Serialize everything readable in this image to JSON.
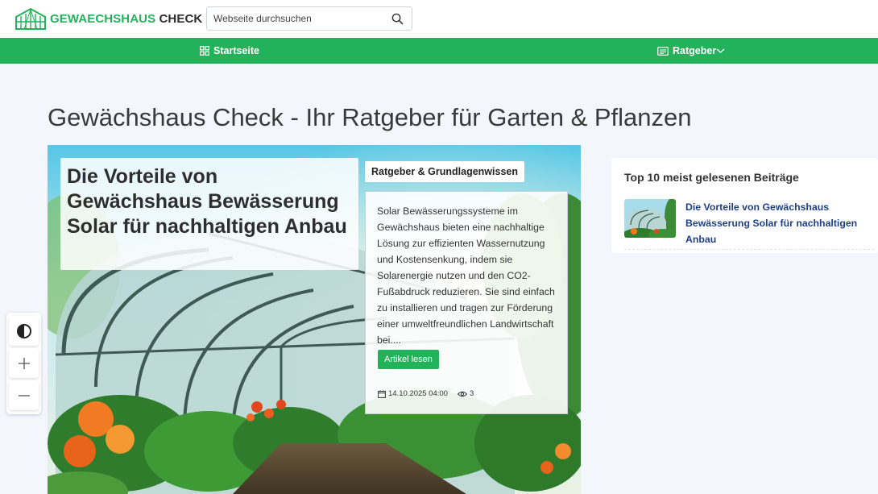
{
  "header": {
    "logo": {
      "brand_green": "GEWAECHSHAUS",
      "brand_dark": "CHECK",
      "icon": "greenhouse-icon"
    },
    "search": {
      "placeholder": "Webseite durchsuchen",
      "icon": "search-icon"
    }
  },
  "nav": {
    "items": [
      {
        "label": "Startseite",
        "icon": "grid-icon"
      },
      {
        "label": "Ratgeber",
        "icon": "newspaper-icon",
        "dropdown_icon": "chevron-down-icon"
      }
    ]
  },
  "main": {
    "page_title": "Gewächshaus Check - Ihr Ratgeber für Garten & Pflanzen",
    "hero": {
      "title": "Die Vorteile von Gewächshaus Bewässerung Solar für nachhaltigen Anbau",
      "category": "Ratgeber & Grundlagenwissen",
      "excerpt": "Solar Bewässerungssysteme im Gewächshaus bieten eine nachhaltige Lösung zur effizienten Wassernutzung und Kostensenkung, indem sie Solarenergie nutzen und den CO2-Fußabdruck reduzieren. Sie sind einfach zu installieren und tragen zur Förderung einer umweltfreundlichen Landwirtschaft bei....",
      "button_label": "Artikel lesen",
      "date": "14.10.2025 04:00",
      "views": "3"
    }
  },
  "accessibility": {
    "buttons": [
      {
        "icon": "contrast-icon"
      },
      {
        "icon": "zoom-in-icon"
      },
      {
        "icon": "zoom-out-icon"
      }
    ]
  },
  "sidebar": {
    "title": "Top 10 meist gelesenen Beiträge",
    "items": [
      {
        "title": "Die Vorteile von Gewächshaus Bewässerung Solar für nachhaltigen Anbau"
      }
    ]
  },
  "colors": {
    "accent": "#22b35a",
    "link": "#1d3f8a",
    "background": "#f3f7fd"
  }
}
